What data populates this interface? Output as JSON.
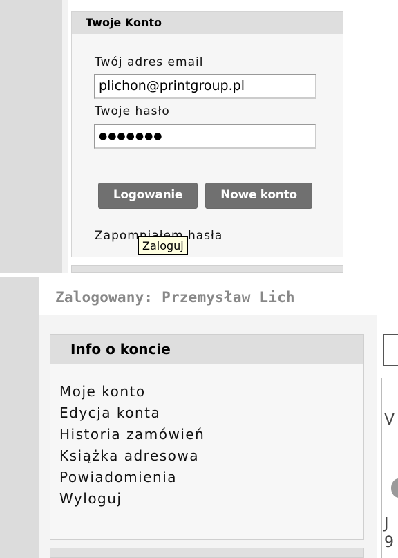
{
  "login_panel": {
    "title": "Twoje Konto",
    "email_label": "Twój adres email",
    "email_value": "plichon@printgroup.pl",
    "password_label": "Twoje hasło",
    "password_mask": "●●●●●●●",
    "login_button": "Logowanie",
    "new_account_button": "Nowe konto",
    "forgot_password": "Zapomniałem hasła",
    "tooltip": "Zaloguj"
  },
  "account_panel": {
    "logged_in_text": "Zalogowany: Przemysław Lich",
    "title": "Info o koncie",
    "menu": [
      "Moje konto",
      "Edycja konta",
      "Historia zamówień",
      "Książka adresowa",
      "Powiadomienia",
      "Wyloguj"
    ],
    "right_glyphs": [
      "V",
      "J",
      "9"
    ]
  }
}
